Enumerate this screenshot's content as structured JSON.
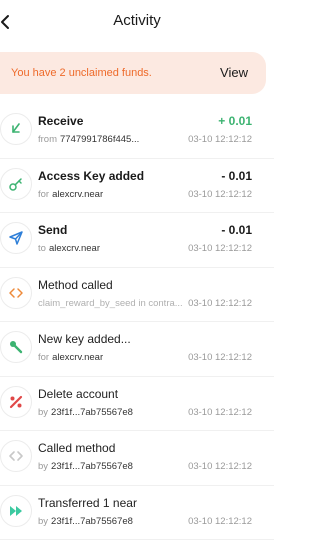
{
  "header": {
    "title": "Activity"
  },
  "banner": {
    "text": "You have 2 unclaimed funds.",
    "action": "View"
  },
  "colors": {
    "positive": "#3cb371",
    "banner_bg": "#fce9e1",
    "banner_text": "#ee6a2a"
  },
  "activities": [
    {
      "icon": "receive-icon",
      "title": "Receive",
      "prefix": "from",
      "sub": "7747991786f445...",
      "amount": "+ 0.01",
      "time": "03-10 12:12:12"
    },
    {
      "icon": "key-icon",
      "title": "Access Key added",
      "prefix": "for",
      "sub": "alexcrv.near",
      "amount": "- 0.01",
      "time": "03-10 12:12:12"
    },
    {
      "icon": "send-icon",
      "title": "Send",
      "prefix": "to",
      "sub": "alexcrv.near",
      "amount": "- 0.01",
      "time": "03-10 12:12:12"
    },
    {
      "icon": "code-icon",
      "title": "Method called",
      "prefix": "",
      "sub": "claim_reward_by_seed in contra...",
      "amount": "",
      "time": "03-10 12:12:12"
    },
    {
      "icon": "new-key-icon",
      "title": "New key added...",
      "prefix": "for",
      "sub": "alexcrv.near",
      "amount": "",
      "time": "03-10 12:12:12"
    },
    {
      "icon": "delete-account-icon",
      "title": "Delete account",
      "prefix": "by",
      "sub": "23f1f...7ab75567e8",
      "amount": "",
      "time": "03-10 12:12:12"
    },
    {
      "icon": "called-method-icon",
      "title": "Called method",
      "prefix": "by",
      "sub": "23f1f...7ab75567e8",
      "amount": "",
      "time": "03-10 12:12:12"
    },
    {
      "icon": "transfer-icon",
      "title": "Transferred 1 near",
      "prefix": "by",
      "sub": "23f1f...7ab75567e8",
      "amount": "",
      "time": "03-10 12:12:12"
    }
  ]
}
